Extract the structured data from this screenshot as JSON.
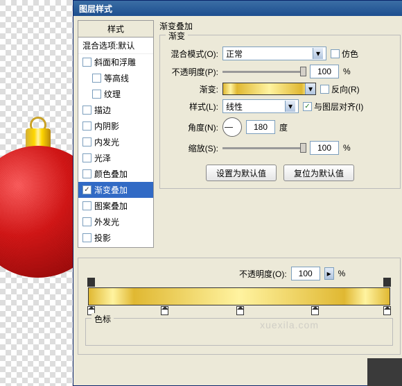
{
  "dialog": {
    "title": "图层样式",
    "styles_header": "样式",
    "blend_options": "混合选项:默认",
    "items": [
      {
        "label": "斜面和浮雕",
        "checked": false
      },
      {
        "label": "等高线",
        "checked": false,
        "indent": true
      },
      {
        "label": "纹理",
        "checked": false,
        "indent": true
      },
      {
        "label": "描边",
        "checked": false
      },
      {
        "label": "内阴影",
        "checked": false
      },
      {
        "label": "内发光",
        "checked": false
      },
      {
        "label": "光泽",
        "checked": false
      },
      {
        "label": "颜色叠加",
        "checked": false
      },
      {
        "label": "渐变叠加",
        "checked": true,
        "selected": true
      },
      {
        "label": "图案叠加",
        "checked": false
      },
      {
        "label": "外发光",
        "checked": false
      },
      {
        "label": "投影",
        "checked": false
      }
    ]
  },
  "settings": {
    "title": "渐变叠加",
    "group": "渐变",
    "blend_mode_label": "混合模式(O):",
    "blend_mode_value": "正常",
    "dither_label": "仿色",
    "opacity_label": "不透明度(P):",
    "opacity_value": "100",
    "opacity_unit": "%",
    "gradient_label": "渐变:",
    "reverse_label": "反向(R)",
    "style_label": "样式(L):",
    "style_value": "线性",
    "align_label": "与图层对齐(I)",
    "angle_label": "角度(N):",
    "angle_value": "180",
    "angle_unit": "度",
    "scale_label": "缩放(S):",
    "scale_value": "100",
    "scale_unit": "%",
    "btn_default": "设置为默认值",
    "btn_reset": "复位为默认值"
  },
  "editor": {
    "opacity_label": "不透明度(O):",
    "opacity_value": "100",
    "opacity_unit": "%",
    "stops_label": "色标"
  },
  "watermark": "xuexila.com"
}
